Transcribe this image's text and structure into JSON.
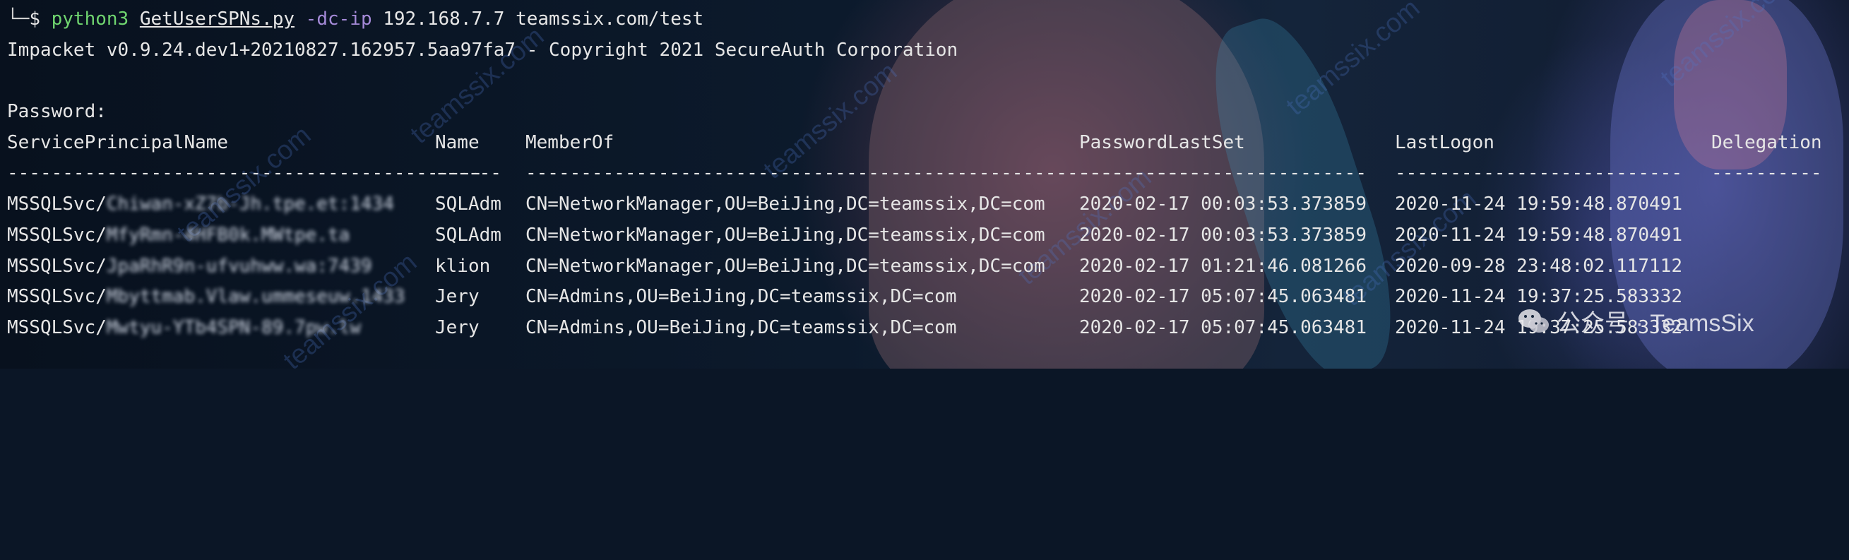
{
  "terminal": {
    "command": {
      "corner": "└─",
      "prompt": "$",
      "program": "python3",
      "script": "GetUserSPNs.py",
      "flag": "-dc-ip",
      "ip": "192.168.7.7",
      "target": "teamssix.com/test"
    },
    "banner": "Impacket v0.9.24.dev1+20210827.162957.5aa97fa7 - Copyright 2021 SecureAuth Corporation",
    "password_prompt": "Password:",
    "table": {
      "headers": [
        "ServicePrincipalName",
        "Name",
        "MemberOf",
        "PasswordLastSet",
        "LastLogon",
        "Delegation"
      ],
      "separators": [
        "-------------------------------------------",
        "------",
        "-------------------------------------------------------------",
        "--------------------------",
        "--------------------------",
        "----------"
      ],
      "rows": [
        {
          "spn_prefix": "MSSQLSvc/",
          "spn_redacted": "Chiwan-xZ7b-Jh.tpe.et:1434",
          "name": "SQLAdm",
          "memberof": "CN=NetworkManager,OU=BeiJing,DC=teamssix,DC=com",
          "pwdlastset": "2020-02-17 00:03:53.373859",
          "lastlogon": "2020-11-24 19:59:48.870491",
          "delegation": ""
        },
        {
          "spn_prefix": "MSSQLSvc/",
          "spn_redacted": "MfyRmn-4HFB0k.MWtpe.ta",
          "name": "SQLAdm",
          "memberof": "CN=NetworkManager,OU=BeiJing,DC=teamssix,DC=com",
          "pwdlastset": "2020-02-17 00:03:53.373859",
          "lastlogon": "2020-11-24 19:59:48.870491",
          "delegation": ""
        },
        {
          "spn_prefix": "MSSQLSvc/",
          "spn_redacted": "JpaRhR9n-ufvuhww.wa:7439",
          "name": "klion",
          "memberof": "CN=NetworkManager,OU=BeiJing,DC=teamssix,DC=com",
          "pwdlastset": "2020-02-17 01:21:46.081266",
          "lastlogon": "2020-09-28 23:48:02.117112",
          "delegation": ""
        },
        {
          "spn_prefix": "MSSQLSvc/",
          "spn_redacted": "Mbyttmab.Vlaw.ummeseuw.1433",
          "name": "Jery",
          "memberof": "CN=Admins,OU=BeiJing,DC=teamssix,DC=com",
          "pwdlastset": "2020-02-17 05:07:45.063481",
          "lastlogon": "2020-11-24 19:37:25.583332",
          "delegation": ""
        },
        {
          "spn_prefix": "MSSQLSvc/",
          "spn_redacted": "Mwtyu-YTb4SPN-89.7pw.lw",
          "name": "Jery",
          "memberof": "CN=Admins,OU=BeiJing,DC=teamssix,DC=com",
          "pwdlastset": "2020-02-17 05:07:45.063481",
          "lastlogon": "2020-11-24 19:37:25.583332",
          "delegation": ""
        }
      ]
    }
  },
  "watermark": {
    "text": "teamssix.com",
    "badge_label": "公众号 · TeamsSix"
  }
}
